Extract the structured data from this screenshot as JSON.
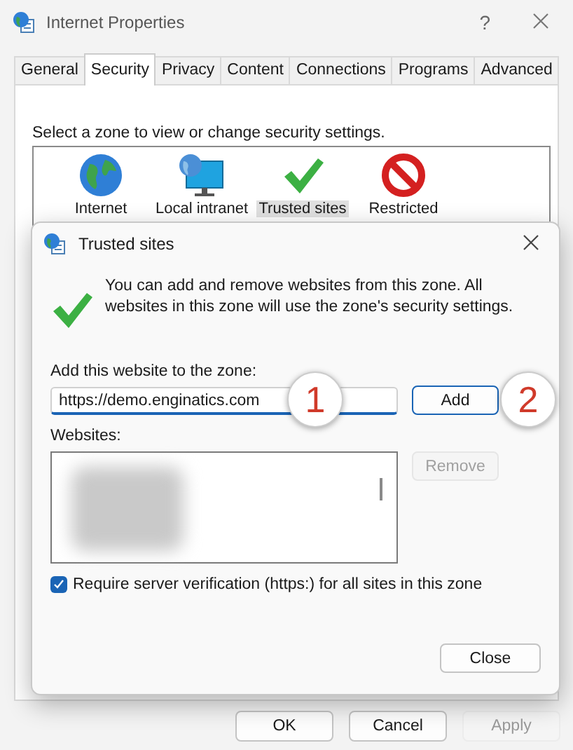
{
  "window": {
    "title": "Internet Properties",
    "help": "?"
  },
  "tabs": [
    {
      "label": "General",
      "selected": false
    },
    {
      "label": "Security",
      "selected": true
    },
    {
      "label": "Privacy",
      "selected": false
    },
    {
      "label": "Content",
      "selected": false
    },
    {
      "label": "Connections",
      "selected": false
    },
    {
      "label": "Programs",
      "selected": false
    },
    {
      "label": "Advanced",
      "selected": false
    }
  ],
  "zone_prompt": "Select a zone to view or change security settings.",
  "zones": [
    {
      "kind": "globe",
      "label": "Internet",
      "selected": false
    },
    {
      "kind": "intranet",
      "label": "Local intranet",
      "selected": false
    },
    {
      "kind": "check",
      "label": "Trusted sites",
      "selected": true
    },
    {
      "kind": "blocked",
      "label": "Restricted",
      "selected": false
    }
  ],
  "dialog": {
    "title": "Trusted sites",
    "message": "You can add and remove websites from this zone. All websites in this zone will use the zone's security settings.",
    "add_label": "Add this website to the zone:",
    "url": "https://demo.enginatics.com",
    "add_button": "Add",
    "websites_label": "Websites:",
    "remove_button": {
      "label": "Remove",
      "disabled": true
    },
    "require_https": {
      "label": "Require server verification (https:) for all sites in this zone",
      "checked": true
    },
    "close_button": "Close"
  },
  "callouts": [
    "1",
    "2"
  ],
  "buttons": [
    {
      "label": "OK",
      "disabled": false
    },
    {
      "label": "Cancel",
      "disabled": false
    },
    {
      "label": "Apply",
      "disabled": true
    }
  ]
}
